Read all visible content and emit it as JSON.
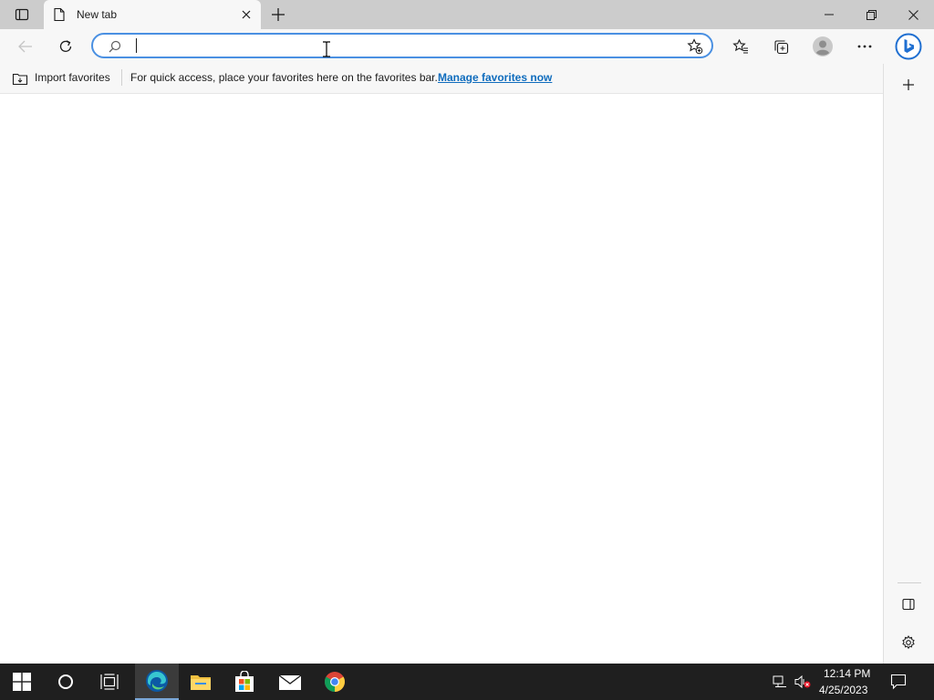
{
  "browser": {
    "tab": {
      "title": "New tab"
    },
    "address_bar": {
      "value": "",
      "placeholder": ""
    },
    "favorites_bar": {
      "import_label": "Import favorites",
      "message": "For quick access, place your favorites here on the favorites bar.",
      "manage_link": "Manage favorites now"
    }
  },
  "taskbar": {
    "clock": {
      "time": "12:14 PM",
      "date": "4/25/2023"
    }
  },
  "colors": {
    "accent": "#0f6cbd",
    "address_border": "#4a90e2",
    "taskbar_bg": "#1f1f1f",
    "tabstrip_bg": "#cccccc"
  }
}
